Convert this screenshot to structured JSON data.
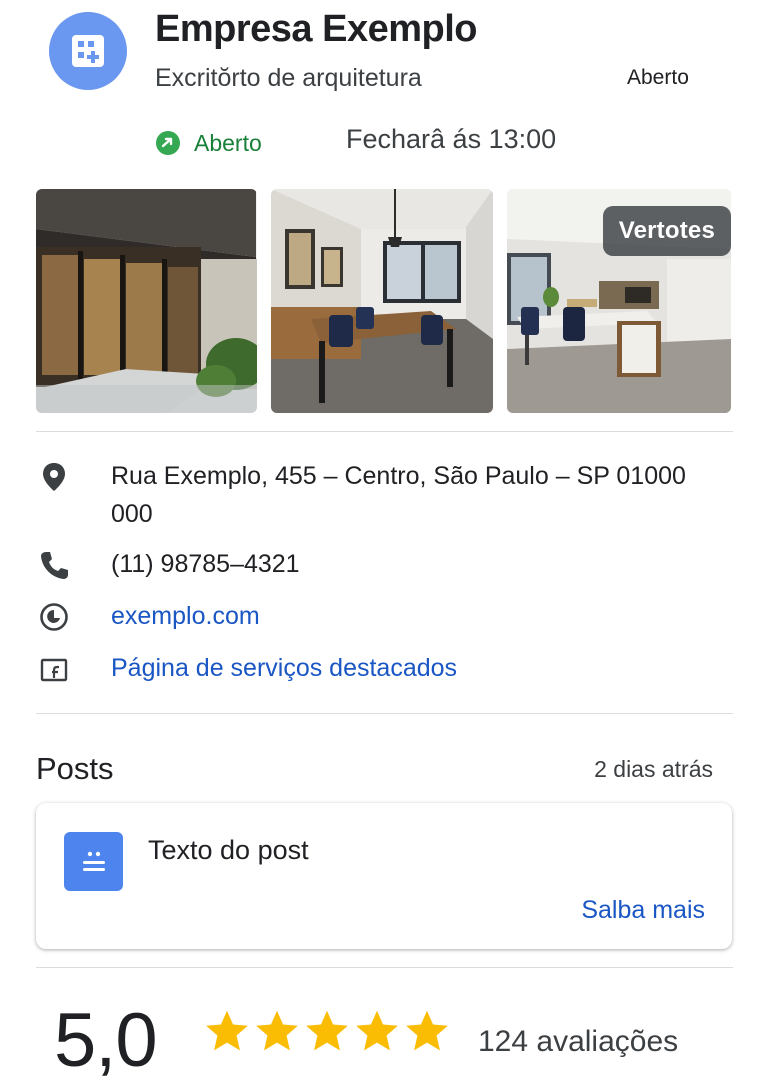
{
  "business": {
    "name": "Empresa Exemplo",
    "category": "Excritŏrto de arquitetura",
    "status_badge": "Aberto"
  },
  "status": {
    "open_label": "Aberto",
    "hours_text": "Fecharâ ás 13:00",
    "open_color": "#188038"
  },
  "photos": {
    "see_all_label": "Vertotes"
  },
  "info": {
    "address": "Rua Exemplo, 455 – Centro, São Paulo – SP 01000 000",
    "phone": "(11) 98785–4321",
    "website": "exemplo.com",
    "services_link": "Página de serviços destacados",
    "icons": [
      "location-pin-icon",
      "phone-icon",
      "website-icon",
      "services-page-icon"
    ],
    "link_color": "#1a56c4"
  },
  "posts": {
    "title": "Posts",
    "date": "2 dias atrás",
    "items": [
      {
        "text": "Texto do post",
        "action": "Salba mais"
      }
    ]
  },
  "rating": {
    "score": "5,0",
    "stars": 5,
    "max_stars": 5,
    "reviews_text": "124 avaliações",
    "star_color": "#fbbc04"
  }
}
